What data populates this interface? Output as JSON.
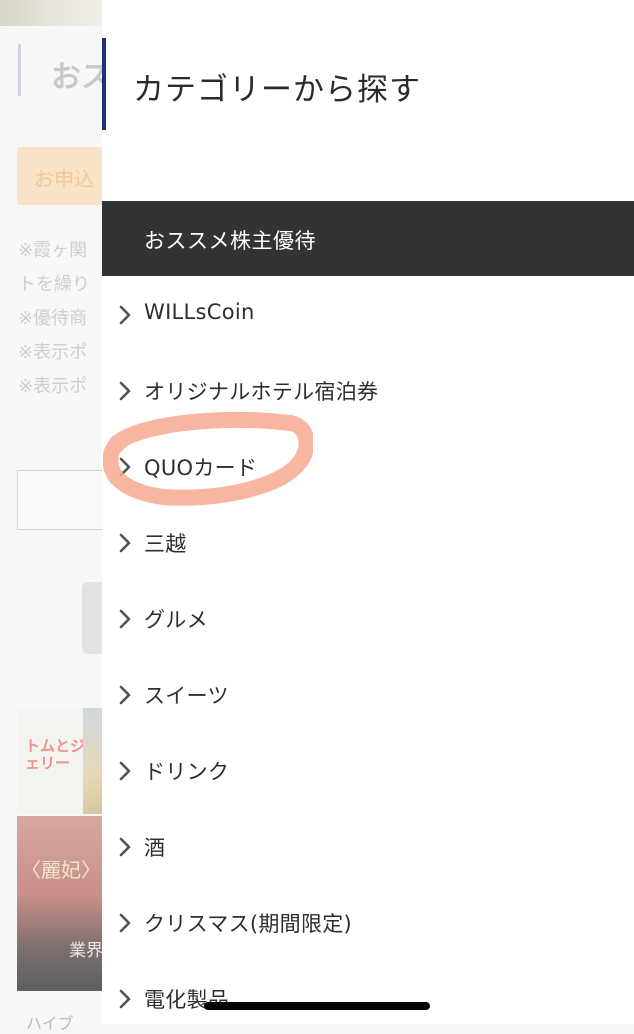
{
  "background": {
    "heading_fragment": "おス",
    "apply_fragment": "お申込",
    "notes": [
      "※霞ヶ関",
      "トを繰り",
      "※優待商",
      "※表示ポ",
      "※表示ポ"
    ],
    "banner1_logo": "トムとジェリー",
    "banner2_title": "〈麗妃〉",
    "banner2_caption": "業界",
    "bottom_text": "ハイブ"
  },
  "drawer": {
    "title": "カテゴリーから探す",
    "section_header": "おススメ株主優待",
    "accent_color": "#22307a",
    "header_bg_color": "#333333",
    "categories": [
      {
        "label": "WILLsCoin"
      },
      {
        "label": "オリジナルホテル宿泊券"
      },
      {
        "label": "QUOカード"
      },
      {
        "label": "三越"
      },
      {
        "label": "グルメ"
      },
      {
        "label": "スイーツ"
      },
      {
        "label": "ドリンク"
      },
      {
        "label": "酒"
      },
      {
        "label": "クリスマス(期間限定)"
      },
      {
        "label": "電化製品"
      }
    ]
  },
  "annotation": {
    "type": "highlighter-circle",
    "color": "#f7a990",
    "target": "QUOカード"
  },
  "icons": {
    "category_chevron": "chevron-right-icon"
  }
}
